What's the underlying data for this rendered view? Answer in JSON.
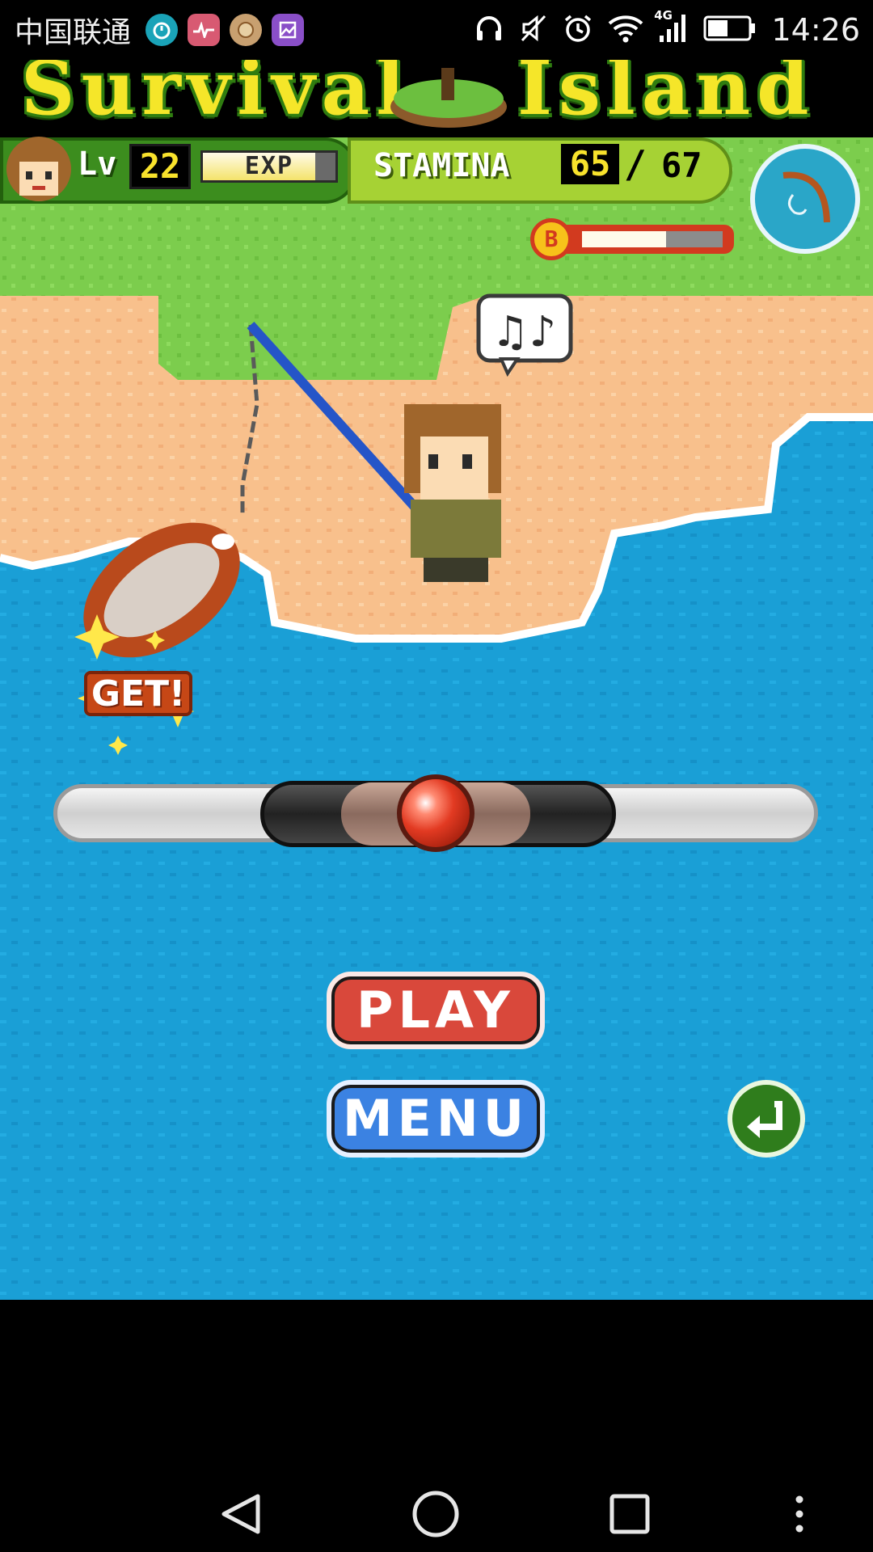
{
  "status_bar": {
    "carrier": "中国联通",
    "network": "4G",
    "time": "14:26",
    "icons": [
      "timer-icon",
      "heart-app-icon",
      "stamp-app-icon",
      "gallery-icon",
      "headphones-icon",
      "mute-icon",
      "alarm-icon",
      "wifi-icon",
      "signal-icon",
      "battery-icon"
    ]
  },
  "game": {
    "title_left": "Survival",
    "title_right": "Island",
    "hud": {
      "level_label": "Lv",
      "level": "22",
      "exp_label": "EXP",
      "exp_progress": 0.85,
      "stamina_label": "STAMINA",
      "stamina_current": "65",
      "stamina_separator": "/",
      "stamina_max": "67",
      "bait_label": "B",
      "bait_progress": 0.6
    },
    "catch_label": "GET!",
    "tension_position": 0.5,
    "buttons": {
      "play": "PLAY",
      "menu": "MENU"
    }
  },
  "colors": {
    "grass": "#7ccd4d",
    "sand": "#f8c08c",
    "sea": "#1a9fd6",
    "play": "#d9483b",
    "menu": "#3b82e2",
    "back": "#2f7d1c"
  },
  "nav_bar": {
    "icons": [
      "back-triangle-icon",
      "home-circle-icon",
      "recents-square-icon",
      "more-dots-icon"
    ]
  }
}
